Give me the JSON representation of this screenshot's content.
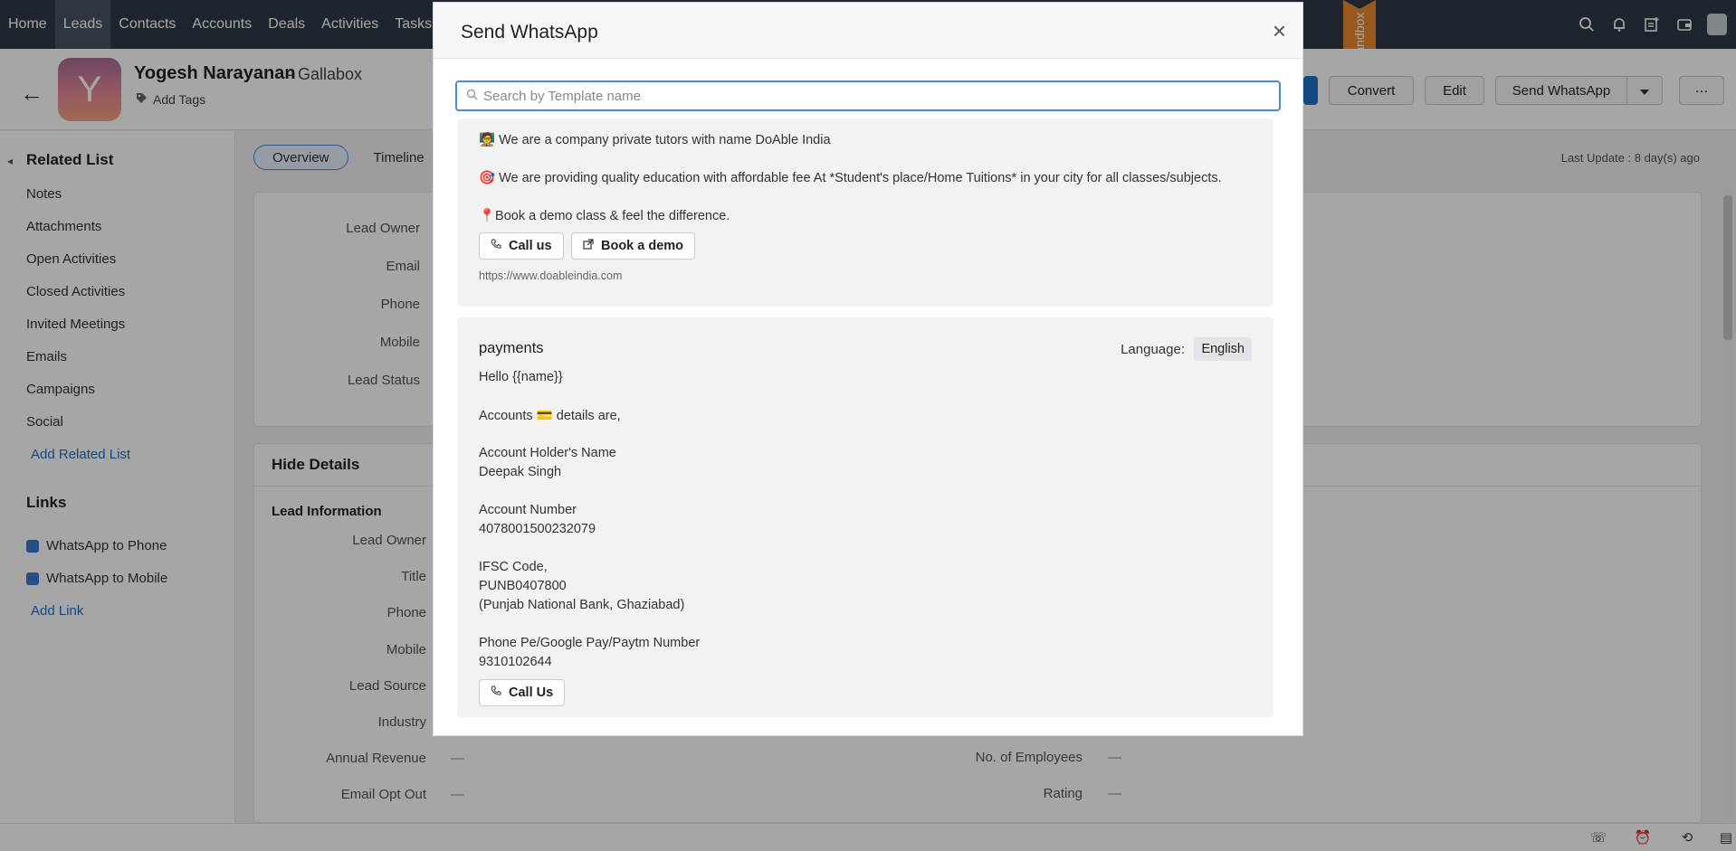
{
  "nav": {
    "items": [
      "Home",
      "Leads",
      "Contacts",
      "Accounts",
      "Deals",
      "Activities",
      "Tasks"
    ],
    "active": "Leads",
    "sandbox_label": "Sandbox",
    "icons": [
      "search-icon",
      "bell-icon",
      "add-record-icon",
      "wallet-icon",
      "profile-avatar"
    ]
  },
  "record": {
    "avatar_letter": "Y",
    "name": "Yogesh Narayanan",
    "company": "- Gallabox",
    "add_tags": "Add Tags",
    "buttons": {
      "convert": "Convert",
      "edit": "Edit",
      "send_whatsapp": "Send WhatsApp",
      "more": "···"
    }
  },
  "sidebar": {
    "related_title": "Related List",
    "related_items": [
      "Notes",
      "Attachments",
      "Open Activities",
      "Closed Activities",
      "Invited Meetings",
      "Emails",
      "Campaigns",
      "Social"
    ],
    "add_related": "Add Related List",
    "links_title": "Links",
    "links": [
      "WhatsApp to Phone",
      "WhatsApp to Mobile"
    ],
    "add_link": "Add Link"
  },
  "main": {
    "tabs": [
      "Overview",
      "Timeline"
    ],
    "last_update": "Last Update : 8 day(s) ago",
    "summary_labels": [
      "Lead Owner",
      "Email",
      "Phone",
      "Mobile",
      "Lead Status"
    ],
    "hide_details": "Hide Details",
    "lead_information": "Lead Information",
    "detail_labels": [
      "Lead Owner",
      "Title",
      "Phone",
      "Mobile",
      "Lead Source",
      "Industry",
      "Annual Revenue",
      "Email Opt Out"
    ],
    "detail_values": [
      "—",
      "—"
    ],
    "right_labels": [
      "No. of Employees",
      "Rating"
    ],
    "right_values": [
      "—",
      "—"
    ]
  },
  "modal": {
    "title": "Send WhatsApp",
    "close": "×",
    "search_placeholder": "Search by Template name",
    "template1": {
      "lines": [
        "🧑‍🏫 We are a company private tutors with name DoAble India",
        "🎯 We are providing quality education with affordable fee At *Student's place/Home Tuitions* in your city for all classes/subjects.",
        "📍Book a demo class & feel the difference."
      ],
      "buttons": [
        "Call us",
        "Book a demo"
      ],
      "url": "https://www.doableindia.com"
    },
    "template2": {
      "name": "payments",
      "language_label": "Language:",
      "language": "English",
      "lines": [
        "Hello {{name}}",
        "Accounts 💳 details are,",
        "Account Holder's Name",
        "Deepak Singh",
        "Account Number",
        "4078001500232079",
        "IFSC Code,",
        "PUNB0407800",
        "(Punjab National Bank, Ghaziabad)",
        "Phone Pe/Google Pay/Paytm Number",
        "9310102644"
      ],
      "button": "Call Us"
    }
  },
  "colors": {
    "nav_bg": "#313949",
    "accent": "#4a89dc",
    "sandbox": "#e8892f"
  }
}
